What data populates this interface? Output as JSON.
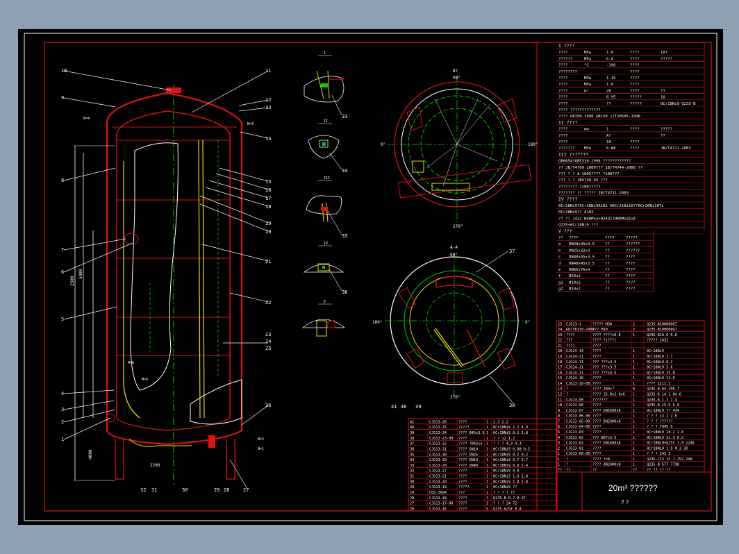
{
  "drawing": {
    "title": "20m³ ??????",
    "title_sub": "? ?",
    "view_b_label": "B?",
    "view_a_label": "A-A",
    "angles_b": [
      "90°",
      "0°",
      "180°",
      "270°"
    ],
    "angles_a": [
      "90°",
      "180°",
      "0°",
      "270°"
    ],
    "detail_labels": [
      "I",
      "II",
      "III",
      "IV",
      "V"
    ],
    "part_numbers_left": [
      "10",
      "9",
      "8",
      "7",
      "6",
      "5",
      "4",
      "3",
      "2",
      "1"
    ],
    "part_numbers_right": [
      "11",
      "12",
      "13",
      "14",
      "15",
      "16",
      "17",
      "18",
      "19",
      "20",
      "21",
      "22",
      "23",
      "24",
      "25",
      "26",
      "27"
    ],
    "part_numbers_bottom": [
      "32",
      "31",
      "30",
      "29",
      "28"
    ],
    "part_numbers_details": [
      "33",
      "34",
      "35",
      "36"
    ],
    "part_numbers_views": [
      "37",
      "38",
      "41",
      "40",
      "39"
    ],
    "nozzle_labels": [
      "N=4",
      "N=3",
      "N=2",
      "N=1",
      "M=8",
      "M=6"
    ],
    "dimension_texts": [
      "2500",
      "5900",
      "4800",
      "2200"
    ]
  },
  "spec_table": {
    "section_I": "I ????",
    "rows_I": [
      [
        "????",
        "MPa",
        "1.0",
        "????",
        "10?"
      ],
      [
        "??????",
        "MPa",
        "0.8",
        "????",
        "?????"
      ],
      [
        "????",
        "°C",
        "-196",
        "????",
        ""
      ],
      [
        "????????",
        "",
        "",
        "????",
        ""
      ],
      [
        "????",
        "MPa",
        "1.15",
        "????",
        ""
      ],
      [
        "????",
        "MPa",
        "1.0",
        "????",
        ""
      ],
      [
        "????",
        "m³",
        "20",
        "????",
        "??"
      ],
      [
        "????",
        "",
        "0.95",
        "?????",
        "10"
      ],
      [
        "????",
        "",
        "??",
        "?????",
        "0Cr18Ni9 Q235-B"
      ]
    ],
    "std_I_1": "????  ?????????????",
    "std_I_2": "????  GB150-1998 GB150.1/T20595-1998",
    "section_II": "II ????",
    "rows_II": [
      [
        "????",
        "mm",
        "1",
        "????",
        "?????"
      ],
      [
        "????",
        "",
        "A?",
        "",
        "??"
      ],
      [
        "????",
        "",
        "10",
        "????",
        ""
      ],
      [
        "???????",
        "MPa",
        "0.88",
        "????",
        "JB/T4711-2003"
      ]
    ],
    "section_III": "III ???????",
    "std_III": "GB6654?GB5310-1998 ????????????",
    "rows_III": [
      "??  JB/T4709-2000???  JB/T4744-2000 ??",
      "??? ? ? A-100X???? ?100???",
      "??? ? ?  JB4730-94 ???",
      "????????  ?100?????"
    ],
    "section_IV_paint": "???????  ??       ?????  JB/T4711-2003",
    "section_IV": "IV ????",
    "rows_IV": [
      "0Cr18Ni9?0Cr18Ni9A102  H0Cr21Ni10??0Cr20Ni10Ti",
      "0Cr18Ni9??        A102",
      "??   ??    J422 H08Mn2+HJ431?H08Mn2SiA",
      "Q235+0Cr18Ni9   ???"
    ],
    "section_V": "V ???",
    "nozzle_header": [
      "??",
      "????",
      "????",
      "?????"
    ],
    "nozzles": [
      [
        "a",
        "DN40x45x3.5",
        "??",
        "??????"
      ],
      [
        "b",
        "DN25x32x3",
        "??",
        "??????"
      ],
      [
        "c",
        "DN40x45x3.5",
        "??",
        "????"
      ],
      [
        "d",
        "DN40x45x3.5",
        "??",
        "????"
      ],
      [
        "e",
        "DN65x76x4",
        "??",
        "????"
      ],
      [
        "f",
        "Ø10x2",
        "??",
        "????"
      ],
      [
        "g1",
        "Ø10x2",
        "??",
        "????"
      ],
      [
        "g2",
        "Ø10x2",
        "??",
        "????"
      ]
    ]
  },
  "parts_right": [
    [
      "25",
      "CJG13-1",
      "?????  M30",
      "2",
      "Q235-B100000G7"
    ],
    [
      "24",
      "GB/T6170-2000",
      "???  M10",
      "2",
      "Q235-B100000G7"
    ],
    [
      "23",
      "????",
      "????  ????x0.8",
      "1",
      "Q235-B10.6  0.6"
    ],
    [
      "22",
      "???",
      "????  ?(???)",
      "",
      "?????  2432"
    ],
    [
      "21",
      "????",
      "????",
      "",
      ""
    ],
    [
      "20",
      "CJG14-14",
      "????",
      "1",
      "0Cr18Ni9"
    ],
    [
      "19",
      "CJG14-11",
      "????",
      "1",
      "0Cr18Ni9  2.7"
    ],
    [
      "18",
      "CJG14-11",
      "??? ???x3.5",
      "1",
      "0Cr18Ni9  0.2"
    ],
    [
      "17",
      "CJG14-11",
      "??? ???x3.5",
      "1",
      "0Cr18Ni9  3.6"
    ],
    [
      "16",
      "CJG14-11",
      "??? ???x3.5",
      "1",
      "0Cr18Ni9  33.8"
    ],
    [
      "15",
      "CJG14-18",
      "????",
      "1",
      "0Cr18Ni9  11.8"
    ],
    [
      "14",
      "CJG13-10-00",
      "????",
      "1",
      "????  1111.1"
    ],
    [
      "13",
      "?",
      "???? 280x7",
      "6",
      "Q235-B  64  398.7"
    ],
    [
      "12",
      "?",
      "???? 25.0x2.0x6",
      "1",
      "Q235-B  14.1  84.6"
    ],
    [
      "11",
      "CJG13-09",
      "???????",
      "1",
      "Q235-B  1.7  7.4"
    ],
    [
      "10",
      "CJG13-08",
      "????",
      "1",
      "Q235-B  15.5  5.9"
    ],
    [
      "9",
      "CJG13-07",
      "???? DN1600x8",
      "1",
      "0Cr18Ni9  ??  434"
    ],
    [
      "8",
      "CJG13-06-00",
      "????",
      "1",
      "?  ?  ?  13.1  2.6"
    ],
    [
      "7",
      "CJG13-05-00",
      "???? DN2400x8",
      "1",
      "?  ?  ?  ??????"
    ],
    [
      "6",
      "CJG13-04-00",
      "????",
      "1",
      "?  ?  ?  7945.9"
    ],
    [
      "5",
      "CJG13-03",
      "????",
      "1",
      "0Cr18Ni9  18.2  1.8"
    ],
    [
      "4",
      "CJG13-02",
      "??? Ø67x5.5",
      "1",
      "0Cr18Ni9  22.3  0.5"
    ],
    [
      "3",
      "CJG13-02",
      "???? DN1600x8",
      "1",
      "0Cr18Ni9+Q235  1.9 2240"
    ],
    [
      "2",
      "CJG13-01",
      "????",
      "1",
      "0Cr18Ni9  1.9  0.3 30"
    ],
    [
      "1",
      "CJG13-00-00",
      "????",
      "1",
      "?  ?  ?  243  2"
    ],
    [
      "1",
      "?",
      "???? ?=8",
      "1",
      "Q235-C15  15.7 252.298"
    ],
    [
      "1",
      "?",
      "???? DN2400x8",
      "1",
      "Q235-B  577  7798"
    ],
    [
      "??",
      "??",
      "??",
      "??",
      "??  ??  ??  ??"
    ]
  ],
  "parts_bottom": [
    [
      "41",
      "CJG13-26",
      "????",
      "1",
      "2.3  2.2"
    ],
    [
      "40",
      "CJG13-25",
      "?????",
      "1",
      "0Cr18Ni9  2.2  4.0"
    ],
    [
      "39",
      "CJG13-24",
      "????  Ø45x3.5",
      "1",
      "0Cr18Ni9  0.1  1.8"
    ],
    [
      "38",
      "CJG13-23-00",
      "????",
      "1",
      "?  ?  12  1.2"
    ],
    [
      "37",
      "CJG13-22",
      "????  ?Ø42x3",
      "1",
      "?  ?  ?  4.3  4.3"
    ],
    [
      "36",
      "CJG13-31",
      "????  DN10",
      "1",
      "0Cr18Ni9  0.08  0.5"
    ],
    [
      "35",
      "CJG13-30",
      "????  DN25",
      "1",
      "0Cr18Ni9  0.2  0.2"
    ],
    [
      "34",
      "CJG13-29",
      "????  DN10",
      "1",
      "0Cr18Ni9  0.7  0.7"
    ],
    [
      "33",
      "CJG13-28",
      "????  DN40",
      "3",
      "0Cr18Ni9  0.8  2.4"
    ],
    [
      "32",
      "CJG13-27",
      "????",
      "1",
      "0Cr18Ni9  0.9"
    ],
    [
      "31",
      "CJG13-21",
      "????",
      "1",
      "0Cr18Ni9  1.8  1.8"
    ],
    [
      "30",
      "CJG13-20",
      "????",
      "1",
      "0Cr18Ni9  1.8  1.8"
    ],
    [
      "29",
      "CJG13-19",
      "?????",
      "1",
      "0Cr18Ni9  ??"
    ],
    [
      "29",
      "CGS-30VA",
      "???",
      "1",
      "?  ?  ?  ?  ??"
    ],
    [
      "28",
      "CJG13-18",
      "????",
      "1",
      "Q235-B  0.7  0.97"
    ],
    [
      "27",
      "CJG13-17-00",
      "????",
      "3",
      "?  ?  ?  24  72"
    ],
    [
      "26",
      "CJG13-16",
      "????",
      "5",
      "Q235-A/GY  8.8"
    ]
  ],
  "colors": {
    "frame_red": "#e01010",
    "green": "#00cc00",
    "white": "#ffffff",
    "yellow": "#e8e000",
    "magenta": "#e040e0",
    "cyan": "#20d0d0"
  }
}
